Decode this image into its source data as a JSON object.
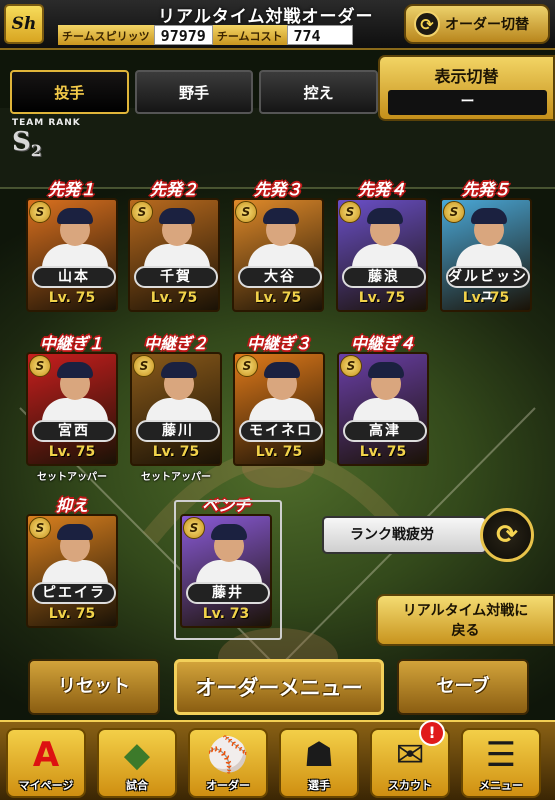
{
  "header": {
    "logo_text": "Sh",
    "title": "リアルタイム対戦オーダー",
    "team_spirit_label": "チームスピリッツ",
    "team_spirit_value": "97979",
    "team_cost_label": "チームコスト",
    "team_cost_value": "774",
    "order_change_label": "オーダー切替"
  },
  "tabs": [
    {
      "label": "投手",
      "active": true
    },
    {
      "label": "野手",
      "active": false
    },
    {
      "label": "控え",
      "active": false
    }
  ],
  "display_toggle": {
    "label": "表示切替",
    "value": "ー"
  },
  "team_rank": {
    "label": "TEAM RANK",
    "grade": "S",
    "level": "2"
  },
  "starters": [
    {
      "position": "先発１",
      "name": "山本",
      "level": "Lv. 75",
      "card_color": "#d9701f"
    },
    {
      "position": "先発２",
      "name": "千賀",
      "level": "Lv. 75",
      "card_color": "#b86a1e"
    },
    {
      "position": "先発３",
      "name": "大谷",
      "level": "Lv. 75",
      "card_color": "#e08a2a"
    },
    {
      "position": "先発４",
      "name": "藤浪",
      "level": "Lv. 75",
      "card_color": "#6a4fc8"
    },
    {
      "position": "先発５",
      "name": "ダルビッシュ",
      "level": "Lv. 75",
      "card_color": "#4aa8d8"
    }
  ],
  "relievers": [
    {
      "position": "中継ぎ１",
      "name": "宮西",
      "level": "Lv. 75",
      "role": "セットアッパー",
      "card_color": "#c81e1e"
    },
    {
      "position": "中継ぎ２",
      "name": "藤川",
      "level": "Lv. 75",
      "role": "セットアッパー",
      "card_color": "#8a5a1a"
    },
    {
      "position": "中継ぎ３",
      "name": "モイネロ",
      "level": "Lv. 75",
      "role": "",
      "card_color": "#e07a1a"
    },
    {
      "position": "中継ぎ４",
      "name": "高津",
      "level": "Lv. 75",
      "role": "",
      "card_color": "#6a3fa8"
    }
  ],
  "closer": {
    "position": "抑え",
    "name": "ピエイラ",
    "level": "Lv. 75",
    "card_color": "#d9801f"
  },
  "bench": {
    "position": "ベンチ",
    "name": "藤井",
    "level": "Lv. 73",
    "card_color": "#8a5ad8"
  },
  "badge_text": "S",
  "side": {
    "fatigue_label": "ランク戦疲労",
    "back_label_line1": "リアルタイム対戦に",
    "back_label_line2": "戻る"
  },
  "bottom_buttons": {
    "reset": "リセット",
    "order_menu": "オーダーメニュー",
    "save": "セーブ"
  },
  "nav": [
    {
      "label": "マイページ",
      "icon": "A"
    },
    {
      "label": "試合",
      "icon": "◆"
    },
    {
      "label": "オーダー",
      "icon": "⚾"
    },
    {
      "label": "選手",
      "icon": "☗"
    },
    {
      "label": "スカウト",
      "icon": "✉"
    },
    {
      "label": "メニュー",
      "icon": "☰"
    }
  ],
  "scout_alert": "!"
}
